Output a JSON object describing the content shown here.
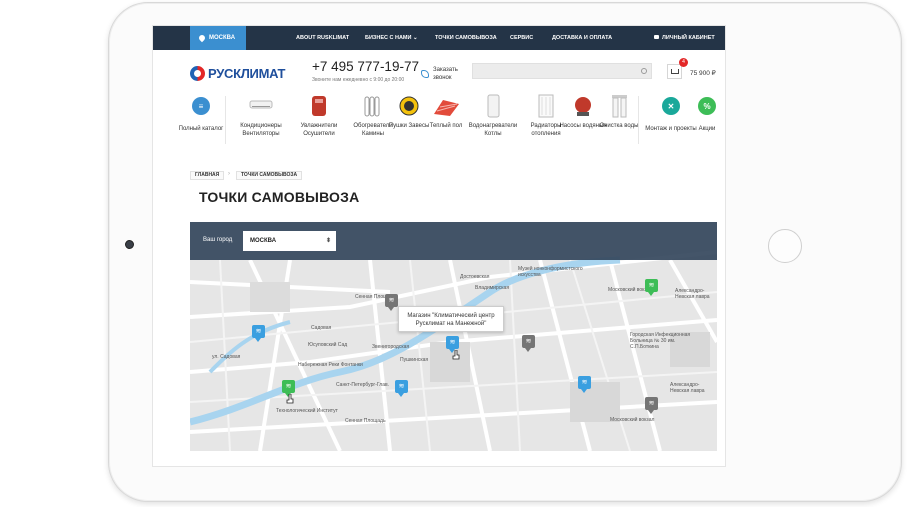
{
  "topnav": {
    "city": "МОСКВА",
    "items": [
      "ABOUT RUSKLIMAT",
      "БИЗНЕС С НАМИ",
      "ТОЧКИ САМОВЫВОЗА",
      "СЕРВИС",
      "ДОСТАВКА И ОПЛАТА"
    ],
    "account": "ЛИЧНЫЙ КАБИНЕТ"
  },
  "header": {
    "logo": "РУСКЛИМАТ",
    "phone": "+7 495 777-19-77",
    "phone_note": "Звоните нам ежедневно с 9:00 до 20:00",
    "callback": "Заказать звонок",
    "search_placeholder": "",
    "cart_count": "4",
    "cart_total": "75 900 ₽"
  },
  "categories": [
    {
      "label": "Полный каталог",
      "icon": "menu-icon"
    },
    {
      "label": "Кондиционеры Вентиляторы",
      "icon": "air-conditioner-icon"
    },
    {
      "label": "Увлажнители Осушители",
      "icon": "humidifier-icon"
    },
    {
      "label": "Обогреватели Камины",
      "icon": "heater-icon"
    },
    {
      "label": "Пушки Завесы",
      "icon": "heat-gun-icon"
    },
    {
      "label": "Теплый пол",
      "icon": "warm-floor-icon"
    },
    {
      "label": "Водонагреватели Котлы",
      "icon": "water-heater-icon"
    },
    {
      "label": "Радиаторы отопления",
      "icon": "radiator-icon"
    },
    {
      "label": "Насосы водяные",
      "icon": "pump-icon"
    },
    {
      "label": "Очистка воды",
      "icon": "water-filter-icon"
    },
    {
      "label": "Монтаж и проекты",
      "icon": "tools-icon"
    },
    {
      "label": "Акции",
      "icon": "percent-icon"
    }
  ],
  "breadcrumb": [
    "ГЛАВНАЯ",
    "ТОЧКИ САМОВЫВОЗА"
  ],
  "page_title": "ТОЧКИ САМОВЫВОЗА",
  "map": {
    "city_label": "Ваш город",
    "city_value": "МОСКВА",
    "tooltip": "Магазин \"Климатический центр Русклимат на Манежной\"",
    "labels": [
      "Садовая",
      "Сенная Площадь",
      "Юсуповский Сад",
      "Звенигородская",
      "Пушкинская",
      "Сенная Площадь",
      "Владимирская",
      "Достоевская",
      "Московский вокзал",
      "Санкт-Петербург-Глав.",
      "Технологический Институт",
      "Московский вокзал",
      "ул. Садовая",
      "Набережная Реки Фонтанки",
      "Городская Инфекционная Больница № 30 им. С.П.Боткина",
      "Александро-Невская лавра",
      "Музей нонконформистского искусства",
      "Александро-Невская лавра"
    ],
    "colors": {
      "blue": "#3a9fe0",
      "green": "#3dbd57",
      "gray": "#757575"
    }
  },
  "colors": {
    "nav_bg": "#243447",
    "accent": "#3b8fd0"
  }
}
